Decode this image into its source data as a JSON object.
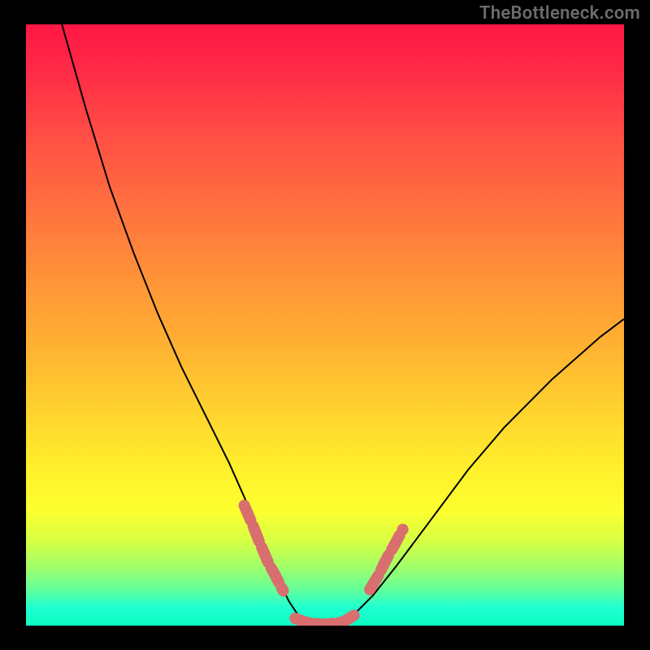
{
  "watermark": "TheBottleneck.com",
  "chart_data": {
    "type": "line",
    "title": "",
    "xlabel": "",
    "ylabel": "",
    "xlim": [
      0,
      1
    ],
    "ylim": [
      0,
      1
    ],
    "series": [
      {
        "name": "bottleneck-curve",
        "x": [
          0.06,
          0.08,
          0.1,
          0.14,
          0.18,
          0.22,
          0.26,
          0.3,
          0.34,
          0.38,
          0.4,
          0.42,
          0.44,
          0.46,
          0.5,
          0.54,
          0.58,
          0.62,
          0.68,
          0.74,
          0.8,
          0.88,
          0.96,
          1.0
        ],
        "y": [
          1.0,
          0.93,
          0.86,
          0.73,
          0.62,
          0.52,
          0.43,
          0.35,
          0.27,
          0.18,
          0.13,
          0.08,
          0.04,
          0.01,
          0.0,
          0.01,
          0.05,
          0.1,
          0.18,
          0.26,
          0.33,
          0.41,
          0.48,
          0.51
        ],
        "stroke": "#000000",
        "stroke_width": 2
      },
      {
        "name": "highlight-left",
        "x": [
          0.365,
          0.38,
          0.39,
          0.405,
          0.415,
          0.43
        ],
        "y": [
          0.2,
          0.165,
          0.14,
          0.105,
          0.087,
          0.058
        ],
        "stroke": "#d96e6e",
        "stroke_width": 14,
        "linecap": "round"
      },
      {
        "name": "highlight-bottom",
        "x": [
          0.45,
          0.47,
          0.5,
          0.53,
          0.55
        ],
        "y": [
          0.012,
          0.005,
          0.002,
          0.006,
          0.018
        ],
        "stroke": "#d96e6e",
        "stroke_width": 14,
        "linecap": "round"
      },
      {
        "name": "highlight-right",
        "x": [
          0.575,
          0.59,
          0.605,
          0.615,
          0.63
        ],
        "y": [
          0.06,
          0.085,
          0.115,
          0.132,
          0.16
        ],
        "stroke": "#d96e6e",
        "stroke_width": 14,
        "linecap": "round"
      }
    ]
  },
  "colors": {
    "highlight": "#d96e6e",
    "curve": "#000000",
    "background": "#000000"
  }
}
